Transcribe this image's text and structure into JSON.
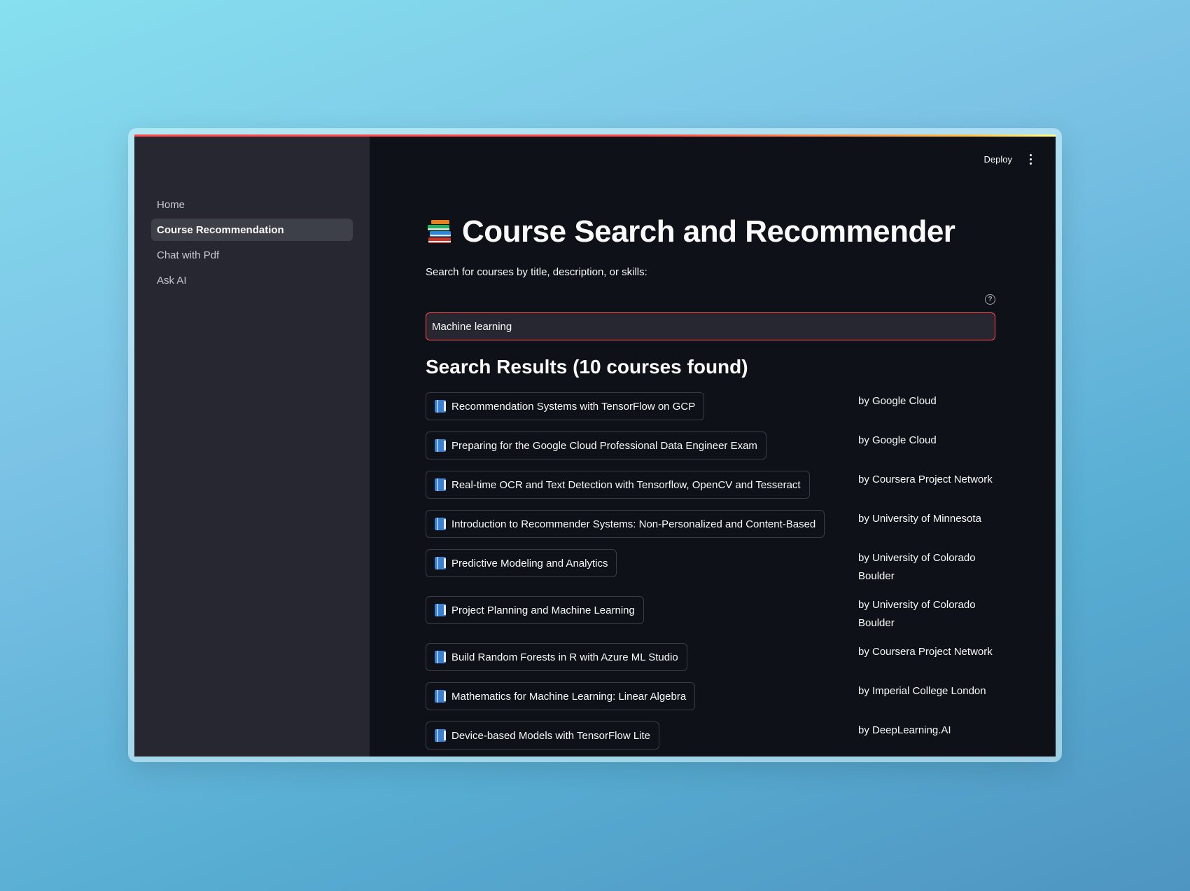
{
  "sidebar": {
    "items": [
      {
        "label": "Home",
        "active": false
      },
      {
        "label": "Course Recommendation",
        "active": true
      },
      {
        "label": "Chat with Pdf",
        "active": false
      },
      {
        "label": "Ask AI",
        "active": false
      }
    ]
  },
  "header": {
    "deploy_label": "Deploy",
    "menu_icon": "kebab-menu-icon"
  },
  "page": {
    "title": "Course Search and Recommender",
    "title_icon": "books-icon",
    "search_label": "Search for courses by title, description, or skills:",
    "search_value": "Machine learning",
    "results_heading": "Search Results (10 courses found)"
  },
  "courses": [
    {
      "title": "Recommendation Systems with TensorFlow on GCP",
      "provider": "by Google Cloud"
    },
    {
      "title": "Preparing for the Google Cloud Professional Data Engineer Exam",
      "provider": "by Google Cloud"
    },
    {
      "title": "Real-time OCR and Text Detection with Tensorflow, OpenCV and Tesseract",
      "provider": "by Coursera Project Network"
    },
    {
      "title": "Introduction to Recommender Systems: Non-Personalized and Content-Based",
      "provider": "by University of Minnesota"
    },
    {
      "title": "Predictive Modeling and Analytics",
      "provider": "by University of Colorado Boulder"
    },
    {
      "title": "Project Planning and Machine Learning",
      "provider": "by University of Colorado Boulder"
    },
    {
      "title": "Build Random Forests in R with Azure ML Studio",
      "provider": "by Coursera Project Network"
    },
    {
      "title": "Mathematics for Machine Learning: Linear Algebra",
      "provider": "by Imperial College London"
    },
    {
      "title": "Device-based Models with TensorFlow Lite",
      "provider": "by DeepLearning.AI"
    }
  ],
  "colors": {
    "accent": "#ff4b4b",
    "sidebar_bg": "#262730",
    "main_bg": "#0e1117",
    "text": "#fafafa"
  }
}
